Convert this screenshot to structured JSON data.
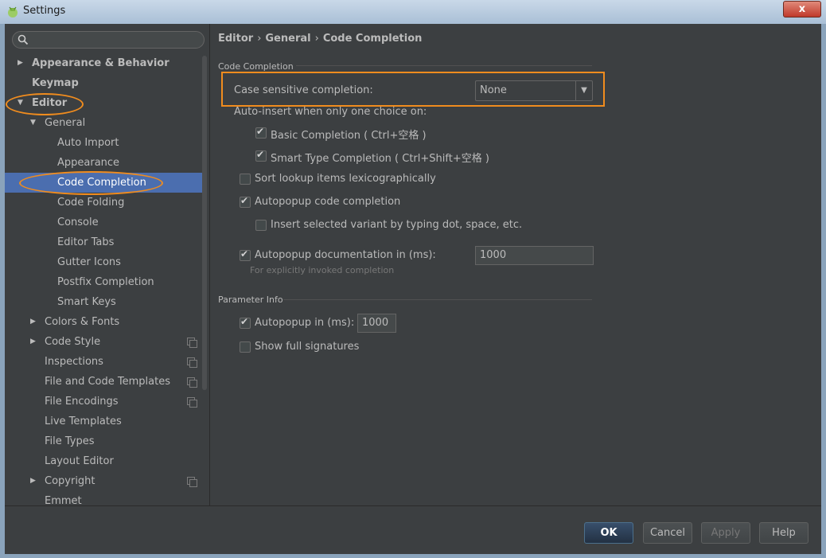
{
  "window": {
    "title": "Settings",
    "close_label": "x"
  },
  "breadcrumb": [
    "Editor",
    "General",
    "Code Completion"
  ],
  "breadcrumb_sep": "›",
  "tree": [
    {
      "label": "Appearance & Behavior",
      "expanded": false
    },
    {
      "label": "Keymap"
    },
    {
      "label": "Editor",
      "expanded": true
    },
    {
      "label": "General",
      "expanded": true
    },
    {
      "label": "Auto Import"
    },
    {
      "label": "Appearance"
    },
    {
      "label": "Code Completion",
      "selected": true
    },
    {
      "label": "Code Folding"
    },
    {
      "label": "Console"
    },
    {
      "label": "Editor Tabs"
    },
    {
      "label": "Gutter Icons"
    },
    {
      "label": "Postfix Completion"
    },
    {
      "label": "Smart Keys"
    },
    {
      "label": "Colors & Fonts",
      "expanded": false
    },
    {
      "label": "Code Style",
      "expanded": false,
      "project_icon": true
    },
    {
      "label": "Inspections",
      "project_icon": true
    },
    {
      "label": "File and Code Templates",
      "project_icon": true
    },
    {
      "label": "File Encodings",
      "project_icon": true
    },
    {
      "label": "Live Templates"
    },
    {
      "label": "File Types"
    },
    {
      "label": "Layout Editor"
    },
    {
      "label": "Copyright",
      "expanded": false,
      "project_icon": true
    },
    {
      "label": "Emmet"
    }
  ],
  "code_completion": {
    "section_title": "Code Completion",
    "case_sensitive_label": "Case sensitive completion:",
    "case_sensitive_value": "None",
    "auto_insert_label": "Auto-insert when only one choice on:",
    "basic_completion": {
      "label": "Basic Completion ( Ctrl+空格 )",
      "checked": true
    },
    "smart_type_completion": {
      "label": "Smart Type Completion ( Ctrl+Shift+空格 )",
      "checked": true
    },
    "sort_lexicographically": {
      "label": "Sort lookup items lexicographically",
      "checked": false
    },
    "autopopup_code": {
      "label": "Autopopup code completion",
      "checked": true
    },
    "insert_selected_variant": {
      "label": "Insert selected variant by typing dot, space, etc.",
      "checked": false
    },
    "autopopup_doc": {
      "label": "Autopopup documentation in (ms):",
      "checked": true,
      "value": "1000"
    },
    "autopopup_doc_hint": "For explicitly invoked completion"
  },
  "parameter_info": {
    "section_title": "Parameter Info",
    "autopopup": {
      "label": "Autopopup in (ms):",
      "checked": true,
      "value": "1000"
    },
    "show_full_signatures": {
      "label": "Show full signatures",
      "checked": false
    }
  },
  "footer": {
    "ok": "OK",
    "cancel": "Cancel",
    "apply": "Apply",
    "help": "Help"
  },
  "colors": {
    "accent_highlight": "#f08c1e",
    "selection": "#4b6eaf",
    "background": "#3c3f41"
  }
}
